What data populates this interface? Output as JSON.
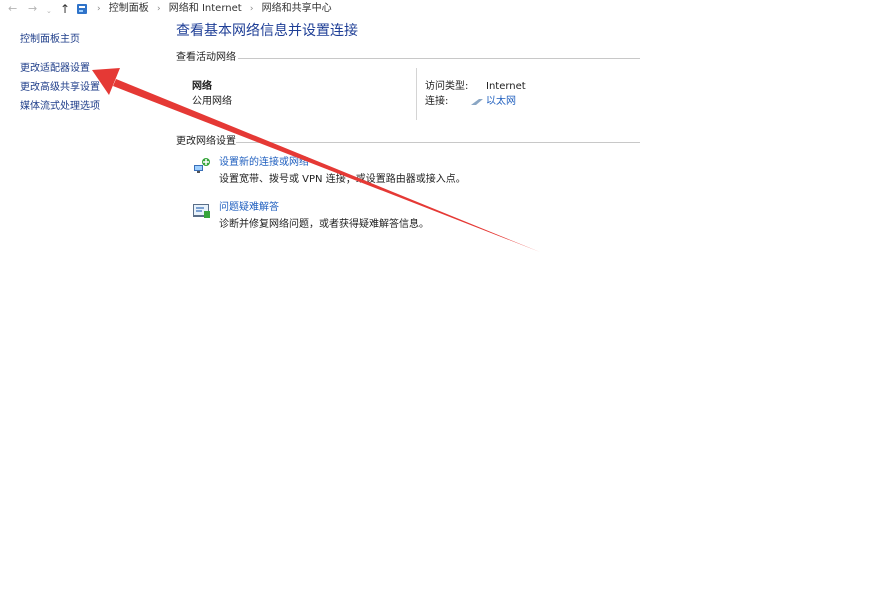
{
  "address_bar": {
    "back_glyph": "←",
    "forward_glyph": "→",
    "dropdown_glyph": "⌄",
    "up_glyph": "↑",
    "breadcrumbs": [
      "控制面板",
      "网络和 Internet",
      "网络和共享中心"
    ],
    "separator": "›"
  },
  "sidebar": {
    "items": [
      {
        "label": "控制面板主页"
      },
      {
        "label": "更改适配器设置"
      },
      {
        "label": "更改高级共享设置"
      },
      {
        "label": "媒体流式处理选项"
      }
    ]
  },
  "main": {
    "title": "查看基本网络信息并设置连接",
    "active_networks_heading": "查看活动网络",
    "network": {
      "name": "网络",
      "type": "公用网络",
      "access_type_label": "访问类型:",
      "access_type_value": "Internet",
      "connection_label": "连接:",
      "connection_value": "以太网"
    },
    "change_settings_heading": "更改网络设置",
    "tasks": [
      {
        "title": "设置新的连接或网络",
        "description": "设置宽带、拨号或 VPN 连接；或设置路由器或接入点。",
        "icon": "network-setup-icon"
      },
      {
        "title": "问题疑难解答",
        "description": "诊断并修复网络问题，或者获得疑难解答信息。",
        "icon": "troubleshoot-icon"
      }
    ]
  },
  "annotation": {
    "color": "#e53935"
  },
  "colors": {
    "link": "#1f5fbf",
    "title": "#1e3e96",
    "sidebar_link": "#1f3e8a"
  }
}
